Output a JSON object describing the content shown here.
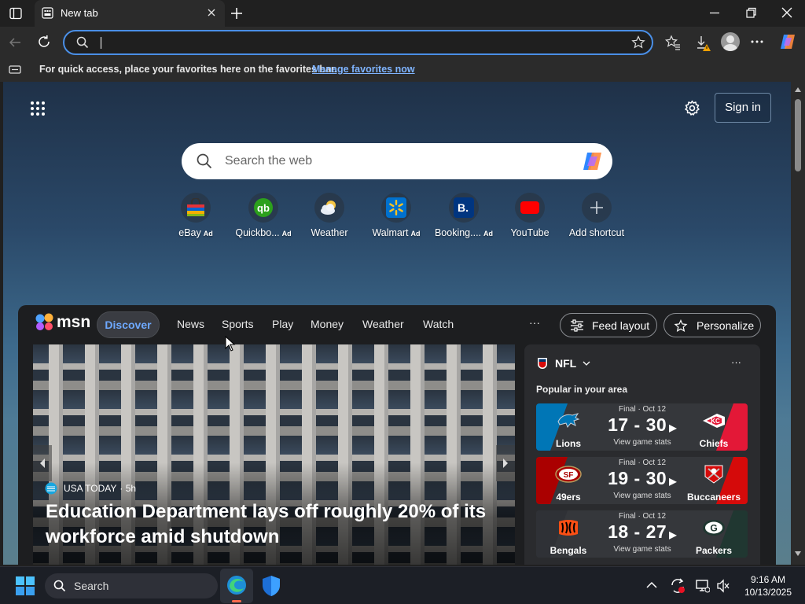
{
  "browser": {
    "tab_title": "New tab",
    "address_value": "",
    "favorites_bar_text": "For quick access, place your favorites here on the favorites bar.",
    "favorites_bar_link": "Manage favorites now"
  },
  "newtab": {
    "sign_in": "Sign in",
    "search_placeholder": "Search the web",
    "shortcuts": [
      {
        "label": "eBay",
        "ad": "Ad",
        "icon": "ebay-bag-icon"
      },
      {
        "label": "Quickbo...",
        "ad": "Ad",
        "icon": "quickbooks-icon"
      },
      {
        "label": "Weather",
        "ad": "",
        "icon": "weather-icon"
      },
      {
        "label": "Walmart",
        "ad": "Ad",
        "icon": "walmart-icon"
      },
      {
        "label": "Booking....",
        "ad": "Ad",
        "icon": "booking-icon"
      },
      {
        "label": "YouTube",
        "ad": "",
        "icon": "youtube-icon"
      },
      {
        "label": "Add shortcut",
        "ad": "",
        "icon": "plus-icon"
      }
    ]
  },
  "msn": {
    "logo_text": "msn",
    "nav": [
      "Discover",
      "News",
      "Sports",
      "Play",
      "Money",
      "Weather",
      "Watch"
    ],
    "more": "···",
    "feed_layout": "Feed layout",
    "personalize": "Personalize",
    "hero": {
      "source": "USA TODAY",
      "age": "· 5h",
      "headline": "Education Department lays off roughly 20% of its workforce amid shutdown"
    },
    "nfl": {
      "title": "NFL",
      "more": "···",
      "subtitle": "Popular in your area",
      "games": [
        {
          "status": "Final · Oct 12",
          "score": "17 - 30",
          "stats": "View game stats",
          "home": "Lions",
          "away": "Chiefs",
          "home_color": "#0076b6",
          "away_color": "#e31837"
        },
        {
          "status": "Final · Oct 12",
          "score": "19 - 30",
          "stats": "View game stats",
          "home": "49ers",
          "away": "Buccaneers",
          "home_color": "#aa0000",
          "away_color": "#d50a0a"
        },
        {
          "status": "Final · Oct 12",
          "score": "18 - 27",
          "stats": "View game stats",
          "home": "Bengals",
          "away": "Packers",
          "home_color": "#3a3c40",
          "away_color": "#203731"
        }
      ]
    }
  },
  "taskbar": {
    "search_label": "Search",
    "time": "9:16 AM",
    "date": "10/13/2025"
  }
}
